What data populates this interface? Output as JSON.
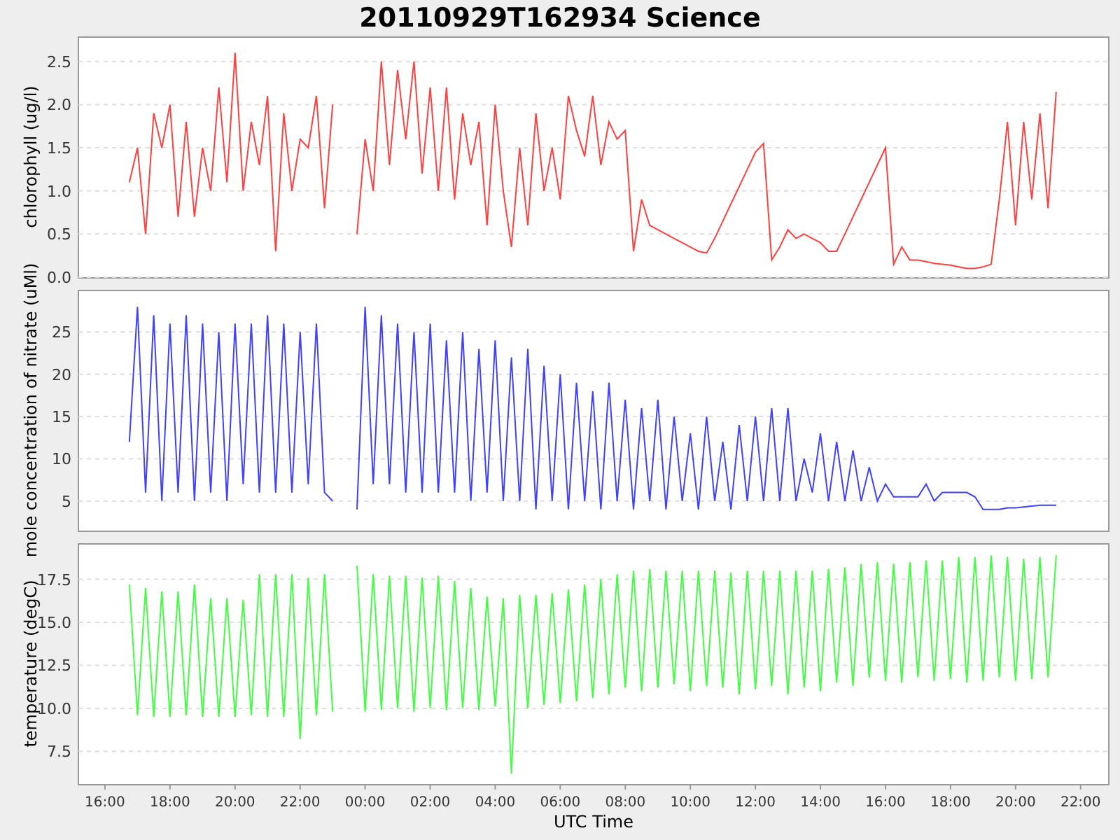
{
  "title": "20110929T162934 Science",
  "panels": [
    {
      "chart_data": {
        "type": "line",
        "grid": true,
        "ylabel": "chlorophyll (ug/l)",
        "xlim": [
          "2011-09-29T15:11",
          "2011-09-30T22:52"
        ],
        "ylim": [
          0,
          2.79
        ],
        "yticks": [
          {
            "value": 0,
            "label": "0.0"
          },
          {
            "value": 0.5,
            "label": "0.5"
          },
          {
            "value": 1,
            "label": "1.0"
          },
          {
            "value": 1.5,
            "label": "1.5"
          },
          {
            "value": 2,
            "label": "2.0"
          },
          {
            "value": 2.5,
            "label": "2.5"
          }
        ],
        "x": [
          "2011-09-29T16:45",
          "2011-09-29T17:00",
          "2011-09-29T17:15",
          "2011-09-29T17:30",
          "2011-09-29T17:45",
          "2011-09-29T18:00",
          "2011-09-29T18:15",
          "2011-09-29T18:30",
          "2011-09-29T18:45",
          "2011-09-29T19:00",
          "2011-09-29T19:15",
          "2011-09-29T19:30",
          "2011-09-29T19:45",
          "2011-09-29T20:00",
          "2011-09-29T20:15",
          "2011-09-29T20:30",
          "2011-09-29T20:45",
          "2011-09-29T21:00",
          "2011-09-29T21:15",
          "2011-09-29T21:30",
          "2011-09-29T21:45",
          "2011-09-29T22:00",
          "2011-09-29T22:15",
          "2011-09-29T22:30",
          "2011-09-29T22:45",
          "2011-09-29T23:00",
          "2011-09-29T23:24",
          "2011-09-29T23:45",
          "2011-09-30T00:00",
          "2011-09-30T00:15",
          "2011-09-30T00:30",
          "2011-09-30T00:45",
          "2011-09-30T01:00",
          "2011-09-30T01:15",
          "2011-09-30T01:30",
          "2011-09-30T01:45",
          "2011-09-30T02:00",
          "2011-09-30T02:15",
          "2011-09-30T02:30",
          "2011-09-30T02:45",
          "2011-09-30T03:00",
          "2011-09-30T03:15",
          "2011-09-30T03:30",
          "2011-09-30T03:45",
          "2011-09-30T04:00",
          "2011-09-30T04:15",
          "2011-09-30T04:30",
          "2011-09-30T04:45",
          "2011-09-30T05:00",
          "2011-09-30T05:15",
          "2011-09-30T05:30",
          "2011-09-30T05:45",
          "2011-09-30T06:00",
          "2011-09-30T06:15",
          "2011-09-30T06:30",
          "2011-09-30T06:45",
          "2011-09-30T07:00",
          "2011-09-30T07:15",
          "2011-09-30T07:30",
          "2011-09-30T07:45",
          "2011-09-30T08:00",
          "2011-09-30T08:15",
          "2011-09-30T08:30",
          "2011-09-30T08:45",
          "2011-09-30T09:00",
          "2011-09-30T09:15",
          "2011-09-30T09:30",
          "2011-09-30T09:45",
          "2011-09-30T10:00",
          "2011-09-30T10:15",
          "2011-09-30T10:30",
          "2011-09-30T10:45",
          "2011-09-30T11:00",
          "2011-09-30T11:15",
          "2011-09-30T11:30",
          "2011-09-30T11:45",
          "2011-09-30T12:00",
          "2011-09-30T12:15",
          "2011-09-30T12:30",
          "2011-09-30T12:45",
          "2011-09-30T13:00",
          "2011-09-30T13:15",
          "2011-09-30T13:30",
          "2011-09-30T13:45",
          "2011-09-30T14:00",
          "2011-09-30T14:15",
          "2011-09-30T14:30",
          "2011-09-30T14:45",
          "2011-09-30T15:00",
          "2011-09-30T15:15",
          "2011-09-30T15:30",
          "2011-09-30T15:45",
          "2011-09-30T16:00",
          "2011-09-30T16:15",
          "2011-09-30T16:30",
          "2011-09-30T16:45",
          "2011-09-30T17:00",
          "2011-09-30T17:15",
          "2011-09-30T17:30",
          "2011-09-30T17:45",
          "2011-09-30T18:00",
          "2011-09-30T18:15",
          "2011-09-30T18:30",
          "2011-09-30T18:45",
          "2011-09-30T19:00",
          "2011-09-30T19:15",
          "2011-09-30T19:30",
          "2011-09-30T19:45",
          "2011-09-30T20:00",
          "2011-09-30T20:15",
          "2011-09-30T20:30",
          "2011-09-30T20:45",
          "2011-09-30T21:00",
          "2011-09-30T21:15"
        ],
        "series": [
          {
            "color": "#ff4040",
            "values": [
              1.1,
              1.5,
              0.5,
              1.9,
              1.5,
              2.0,
              0.7,
              1.8,
              0.7,
              1.5,
              1.0,
              2.2,
              1.1,
              2.6,
              1.0,
              1.8,
              1.3,
              2.1,
              0.3,
              1.9,
              1.0,
              1.6,
              1.5,
              2.1,
              0.8,
              2.0,
              null,
              0.5,
              1.6,
              1.0,
              2.5,
              1.3,
              2.4,
              1.6,
              2.5,
              1.2,
              2.2,
              1.0,
              2.2,
              0.9,
              1.9,
              1.3,
              1.8,
              0.6,
              2.0,
              1.0,
              0.35,
              1.5,
              0.6,
              1.9,
              1.0,
              1.5,
              0.9,
              2.1,
              1.7,
              1.4,
              2.1,
              1.3,
              1.8,
              1.6,
              1.7,
              0.3,
              0.9,
              0.6,
              0.55,
              0.5,
              0.45,
              0.4,
              0.35,
              0.3,
              0.28,
              0.45,
              0.65,
              0.85,
              1.05,
              1.25,
              1.45,
              1.55,
              0.2,
              0.35,
              0.55,
              0.45,
              0.5,
              0.45,
              0.4,
              0.3,
              0.3,
              0.5,
              0.7,
              0.9,
              1.1,
              1.3,
              1.5,
              0.15,
              0.35,
              0.2,
              0.2,
              0.18,
              0.16,
              0.15,
              0.14,
              0.12,
              0.1,
              0.1,
              0.12,
              0.15,
              0.9,
              1.8,
              0.6,
              1.8,
              0.9,
              1.9,
              0.8,
              2.15
            ]
          }
        ]
      }
    },
    {
      "chart_data": {
        "type": "line",
        "grid": true,
        "ylabel": "mole concentration of nitrate (uMl)",
        "xlim": [
          "2011-09-29T15:11",
          "2011-09-30T22:52"
        ],
        "ylim": [
          1.5,
          30
        ],
        "yticks": [
          {
            "value": 5,
            "label": "5"
          },
          {
            "value": 10,
            "label": "10"
          },
          {
            "value": 15,
            "label": "15"
          },
          {
            "value": 20,
            "label": "20"
          },
          {
            "value": 25,
            "label": "25"
          }
        ],
        "x": [
          "2011-09-29T16:45",
          "2011-09-29T17:00",
          "2011-09-29T17:15",
          "2011-09-29T17:30",
          "2011-09-29T17:45",
          "2011-09-29T18:00",
          "2011-09-29T18:15",
          "2011-09-29T18:30",
          "2011-09-29T18:45",
          "2011-09-29T19:00",
          "2011-09-29T19:15",
          "2011-09-29T19:30",
          "2011-09-29T19:45",
          "2011-09-29T20:00",
          "2011-09-29T20:15",
          "2011-09-29T20:30",
          "2011-09-29T20:45",
          "2011-09-29T21:00",
          "2011-09-29T21:15",
          "2011-09-29T21:30",
          "2011-09-29T21:45",
          "2011-09-29T22:00",
          "2011-09-29T22:15",
          "2011-09-29T22:30",
          "2011-09-29T22:45",
          "2011-09-29T23:00",
          "2011-09-29T23:24",
          "2011-09-29T23:45",
          "2011-09-30T00:00",
          "2011-09-30T00:15",
          "2011-09-30T00:30",
          "2011-09-30T00:45",
          "2011-09-30T01:00",
          "2011-09-30T01:15",
          "2011-09-30T01:30",
          "2011-09-30T01:45",
          "2011-09-30T02:00",
          "2011-09-30T02:15",
          "2011-09-30T02:30",
          "2011-09-30T02:45",
          "2011-09-30T03:00",
          "2011-09-30T03:15",
          "2011-09-30T03:30",
          "2011-09-30T03:45",
          "2011-09-30T04:00",
          "2011-09-30T04:15",
          "2011-09-30T04:30",
          "2011-09-30T04:45",
          "2011-09-30T05:00",
          "2011-09-30T05:15",
          "2011-09-30T05:30",
          "2011-09-30T05:45",
          "2011-09-30T06:00",
          "2011-09-30T06:15",
          "2011-09-30T06:30",
          "2011-09-30T06:45",
          "2011-09-30T07:00",
          "2011-09-30T07:15",
          "2011-09-30T07:30",
          "2011-09-30T07:45",
          "2011-09-30T08:00",
          "2011-09-30T08:15",
          "2011-09-30T08:30",
          "2011-09-30T08:45",
          "2011-09-30T09:00",
          "2011-09-30T09:15",
          "2011-09-30T09:30",
          "2011-09-30T09:45",
          "2011-09-30T10:00",
          "2011-09-30T10:15",
          "2011-09-30T10:30",
          "2011-09-30T10:45",
          "2011-09-30T11:00",
          "2011-09-30T11:15",
          "2011-09-30T11:30",
          "2011-09-30T11:45",
          "2011-09-30T12:00",
          "2011-09-30T12:15",
          "2011-09-30T12:30",
          "2011-09-30T12:45",
          "2011-09-30T13:00",
          "2011-09-30T13:15",
          "2011-09-30T13:30",
          "2011-09-30T13:45",
          "2011-09-30T14:00",
          "2011-09-30T14:15",
          "2011-09-30T14:30",
          "2011-09-30T14:45",
          "2011-09-30T15:00",
          "2011-09-30T15:15",
          "2011-09-30T15:30",
          "2011-09-30T15:45",
          "2011-09-30T16:00",
          "2011-09-30T16:15",
          "2011-09-30T16:30",
          "2011-09-30T16:45",
          "2011-09-30T17:00",
          "2011-09-30T17:15",
          "2011-09-30T17:30",
          "2011-09-30T17:45",
          "2011-09-30T18:00",
          "2011-09-30T18:15",
          "2011-09-30T18:30",
          "2011-09-30T18:45",
          "2011-09-30T19:00",
          "2011-09-30T19:15",
          "2011-09-30T19:30",
          "2011-09-30T19:45",
          "2011-09-30T20:00",
          "2011-09-30T20:15",
          "2011-09-30T20:30",
          "2011-09-30T20:45",
          "2011-09-30T21:00",
          "2011-09-30T21:15"
        ],
        "series": [
          {
            "color": "#4040ff",
            "values": [
              12,
              28,
              6,
              27,
              5,
              26,
              6,
              27,
              5,
              26,
              6,
              25,
              5,
              26,
              7,
              26,
              6,
              27,
              6,
              26,
              6,
              25,
              7,
              26,
              6,
              5,
              null,
              4,
              28,
              7,
              27,
              7,
              26,
              6,
              25,
              6,
              26,
              6,
              24,
              6,
              25,
              5,
              23,
              6,
              24,
              5,
              22,
              5,
              23,
              4,
              21,
              5,
              20,
              4,
              19,
              5,
              18,
              4,
              19,
              5,
              17,
              4,
              16,
              5,
              17,
              4,
              15,
              5,
              13,
              4,
              15,
              5,
              12,
              4,
              14,
              5,
              15,
              5,
              16,
              5,
              16,
              5,
              10,
              6,
              13,
              5,
              12,
              5,
              11,
              5,
              9,
              5,
              7,
              5.5,
              5.5,
              5.5,
              5.5,
              7,
              5,
              6,
              6,
              6,
              6,
              5.5,
              4,
              4,
              4,
              4.2,
              4.2,
              4.3,
              4.4,
              4.5,
              4.5,
              4.5
            ]
          }
        ]
      }
    },
    {
      "chart_data": {
        "type": "line",
        "grid": true,
        "ylabel": "temperature (degC)",
        "xlabel": "UTC Time",
        "xlim": [
          "2011-09-29T15:11",
          "2011-09-30T22:52"
        ],
        "ylim": [
          5.6,
          19.6
        ],
        "yticks": [
          {
            "value": 7.5,
            "label": "7.5"
          },
          {
            "value": 10,
            "label": "10.0"
          },
          {
            "value": 12.5,
            "label": "12.5"
          },
          {
            "value": 15,
            "label": "15.0"
          },
          {
            "value": 17.5,
            "label": "17.5"
          }
        ],
        "xticks": [
          {
            "value": "2011-09-29T16:00",
            "label": "16:00"
          },
          {
            "value": "2011-09-29T18:00",
            "label": "18:00"
          },
          {
            "value": "2011-09-29T20:00",
            "label": "20:00"
          },
          {
            "value": "2011-09-29T22:00",
            "label": "22:00"
          },
          {
            "value": "2011-09-30T00:00",
            "label": "00:00"
          },
          {
            "value": "2011-09-30T02:00",
            "label": "02:00"
          },
          {
            "value": "2011-09-30T04:00",
            "label": "04:00"
          },
          {
            "value": "2011-09-30T06:00",
            "label": "06:00"
          },
          {
            "value": "2011-09-30T08:00",
            "label": "08:00"
          },
          {
            "value": "2011-09-30T10:00",
            "label": "10:00"
          },
          {
            "value": "2011-09-30T12:00",
            "label": "12:00"
          },
          {
            "value": "2011-09-30T14:00",
            "label": "14:00"
          },
          {
            "value": "2011-09-30T16:00",
            "label": "16:00"
          },
          {
            "value": "2011-09-30T18:00",
            "label": "18:00"
          },
          {
            "value": "2011-09-30T20:00",
            "label": "20:00"
          },
          {
            "value": "2011-09-30T22:00",
            "label": "22:00"
          }
        ],
        "x": [
          "2011-09-29T16:45",
          "2011-09-29T17:00",
          "2011-09-29T17:15",
          "2011-09-29T17:30",
          "2011-09-29T17:45",
          "2011-09-29T18:00",
          "2011-09-29T18:15",
          "2011-09-29T18:30",
          "2011-09-29T18:45",
          "2011-09-29T19:00",
          "2011-09-29T19:15",
          "2011-09-29T19:30",
          "2011-09-29T19:45",
          "2011-09-29T20:00",
          "2011-09-29T20:15",
          "2011-09-29T20:30",
          "2011-09-29T20:45",
          "2011-09-29T21:00",
          "2011-09-29T21:15",
          "2011-09-29T21:30",
          "2011-09-29T21:45",
          "2011-09-29T22:00",
          "2011-09-29T22:15",
          "2011-09-29T22:30",
          "2011-09-29T22:45",
          "2011-09-29T23:00",
          "2011-09-29T23:24",
          "2011-09-29T23:45",
          "2011-09-30T00:00",
          "2011-09-30T00:15",
          "2011-09-30T00:30",
          "2011-09-30T00:45",
          "2011-09-30T01:00",
          "2011-09-30T01:15",
          "2011-09-30T01:30",
          "2011-09-30T01:45",
          "2011-09-30T02:00",
          "2011-09-30T02:15",
          "2011-09-30T02:30",
          "2011-09-30T02:45",
          "2011-09-30T03:00",
          "2011-09-30T03:15",
          "2011-09-30T03:30",
          "2011-09-30T03:45",
          "2011-09-30T04:00",
          "2011-09-30T04:15",
          "2011-09-30T04:30",
          "2011-09-30T04:45",
          "2011-09-30T05:00",
          "2011-09-30T05:15",
          "2011-09-30T05:30",
          "2011-09-30T05:45",
          "2011-09-30T06:00",
          "2011-09-30T06:15",
          "2011-09-30T06:30",
          "2011-09-30T06:45",
          "2011-09-30T07:00",
          "2011-09-30T07:15",
          "2011-09-30T07:30",
          "2011-09-30T07:45",
          "2011-09-30T08:00",
          "2011-09-30T08:15",
          "2011-09-30T08:30",
          "2011-09-30T08:45",
          "2011-09-30T09:00",
          "2011-09-30T09:15",
          "2011-09-30T09:30",
          "2011-09-30T09:45",
          "2011-09-30T10:00",
          "2011-09-30T10:15",
          "2011-09-30T10:30",
          "2011-09-30T10:45",
          "2011-09-30T11:00",
          "2011-09-30T11:15",
          "2011-09-30T11:30",
          "2011-09-30T11:45",
          "2011-09-30T12:00",
          "2011-09-30T12:15",
          "2011-09-30T12:30",
          "2011-09-30T12:45",
          "2011-09-30T13:00",
          "2011-09-30T13:15",
          "2011-09-30T13:30",
          "2011-09-30T13:45",
          "2011-09-30T14:00",
          "2011-09-30T14:15",
          "2011-09-30T14:30",
          "2011-09-30T14:45",
          "2011-09-30T15:00",
          "2011-09-30T15:15",
          "2011-09-30T15:30",
          "2011-09-30T15:45",
          "2011-09-30T16:00",
          "2011-09-30T16:15",
          "2011-09-30T16:30",
          "2011-09-30T16:45",
          "2011-09-30T17:00",
          "2011-09-30T17:15",
          "2011-09-30T17:30",
          "2011-09-30T17:45",
          "2011-09-30T18:00",
          "2011-09-30T18:15",
          "2011-09-30T18:30",
          "2011-09-30T18:45",
          "2011-09-30T19:00",
          "2011-09-30T19:15",
          "2011-09-30T19:30",
          "2011-09-30T19:45",
          "2011-09-30T20:00",
          "2011-09-30T20:15",
          "2011-09-30T20:30",
          "2011-09-30T20:45",
          "2011-09-30T21:00",
          "2011-09-30T21:15"
        ],
        "series": [
          {
            "color": "#40ff40",
            "values": [
              17.2,
              9.6,
              17,
              9.5,
              16.8,
              9.5,
              16.8,
              9.6,
              17.2,
              9.5,
              16.4,
              9.5,
              16.4,
              9.5,
              16.3,
              9.6,
              17.8,
              9.5,
              17.8,
              9.5,
              17.8,
              8.2,
              17.6,
              9.6,
              17.8,
              9.8,
              null,
              18.3,
              9.8,
              17.8,
              9.9,
              17.7,
              10.0,
              17.7,
              9.8,
              17.6,
              10.0,
              17.7,
              9.9,
              17.4,
              10.0,
              17.0,
              9.9,
              16.5,
              10.1,
              16.4,
              6.2,
              16.6,
              10.0,
              16.6,
              10.2,
              16.7,
              10.3,
              16.9,
              10.4,
              17.2,
              10.6,
              17.5,
              10.8,
              17.8,
              11.2,
              18.0,
              11.0,
              18.1,
              11.2,
              18.0,
              11.4,
              18.0,
              11.0,
              18.0,
              11.3,
              18.0,
              11.2,
              17.9,
              10.8,
              18.0,
              11.1,
              18.0,
              11.3,
              18.0,
              10.8,
              18.0,
              11.2,
              18.0,
              11.0,
              18.1,
              11.5,
              18.2,
              11.3,
              18.4,
              11.8,
              18.5,
              11.6,
              18.4,
              11.5,
              18.5,
              11.8,
              18.6,
              11.6,
              18.6,
              11.7,
              18.8,
              11.5,
              18.8,
              11.6,
              18.9,
              11.8,
              18.8,
              11.6,
              18.7,
              11.7,
              18.8,
              11.8,
              18.9
            ]
          }
        ]
      }
    }
  ]
}
